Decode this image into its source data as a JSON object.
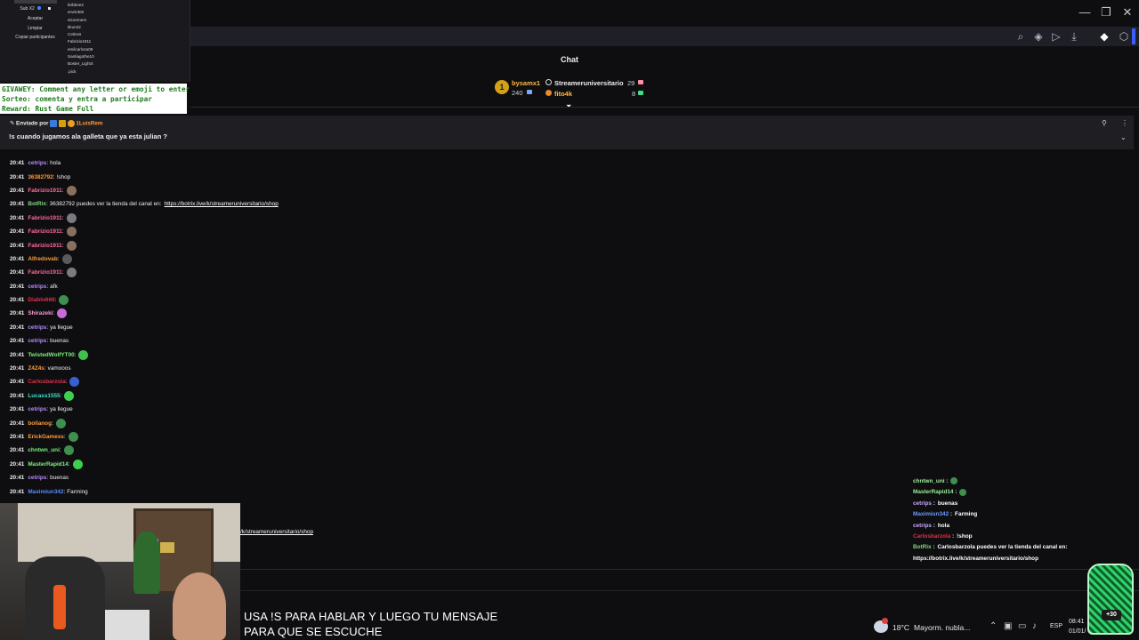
{
  "window": {
    "minimize_glyph": "—",
    "restore_glyph": "❐",
    "close_glyph": "✕"
  },
  "toolbar_icons": [
    "zoom-icon",
    "shield-icon",
    "play-icon",
    "download-icon",
    "extension-icon",
    "package-icon"
  ],
  "giveaway_panel": {
    "sub_label": "Sub X2",
    "accept_label": "Aceptar",
    "clear_label": "Limpiar",
    "copy_label": "Copiar participantes",
    "participants": [
      "birbbee2",
      "erv0r300",
      "elconmers",
      "tikun22",
      "Cetizes",
      "Fabrizio1911",
      "emilcarloza09",
      "Santiagothe10",
      "Boster_LightX",
      ".pick"
    ]
  },
  "giveaway_banner": {
    "line1": "GIVAWEY: Comment any letter or emoji to enter",
    "line2": "Sorteo: comenta y entra a participar",
    "line3": "Reward: Rust Game Full"
  },
  "chat_header": {
    "title": "Chat",
    "top_gifter_rank": "1",
    "top_gifter_name": "bysamx1",
    "top_gifter_count": "240",
    "channel_name": "Streameruniversitario",
    "channel_count": "29",
    "second_name": "fito4k",
    "second_count": "8"
  },
  "pinned": {
    "label": "Enviado por",
    "author": "1LuisRem",
    "message": "!s cuando jugamos ala galleta que ya esta julian ?"
  },
  "messages": [
    {
      "ts": "20:41",
      "user": "cetrips",
      "sep": ":",
      "text": "hola",
      "color": "#b78bff"
    },
    {
      "ts": "20:41",
      "user": "36382792",
      "sep": ":",
      "text": "!shop",
      "color": "#ff9a3c"
    },
    {
      "ts": "20:41",
      "user": "Fabrizio1911",
      "sep": ":",
      "text": "",
      "color": "#ff6b9a",
      "emote": "#8a6f5c"
    },
    {
      "ts": "20:41",
      "user": "BotRix",
      "sep": ":",
      "text": "36382792 puedes ver la tienda del canal en:",
      "link": "https://botrix.live/k/streameruniversitario/shop",
      "color": "#7dd87d"
    },
    {
      "ts": "20:41",
      "user": "Fabrizio1911",
      "sep": ":",
      "text": "",
      "color": "#ff6b9a",
      "emote": "#7a7a80"
    },
    {
      "ts": "20:41",
      "user": "Fabrizio1911",
      "sep": ":",
      "text": "",
      "color": "#ff6b9a",
      "emote": "#8a6f5c"
    },
    {
      "ts": "20:41",
      "user": "Fabrizio1911",
      "sep": ":",
      "text": "",
      "color": "#ff6b9a",
      "emote": "#8a6f5c"
    },
    {
      "ts": "20:41",
      "user": "Alfredovab",
      "sep": ":",
      "text": "",
      "color": "#ff9a3c",
      "emote": "#5a5a5a"
    },
    {
      "ts": "20:41",
      "user": "Fabrizio1911",
      "sep": ":",
      "text": "",
      "color": "#ff6b9a",
      "emote": "#7a7a80"
    },
    {
      "ts": "20:41",
      "user": "cetrips",
      "sep": ":",
      "text": "afk",
      "color": "#b78bff"
    },
    {
      "ts": "20:41",
      "user": "Diablo666",
      "sep": ":",
      "text": "",
      "color": "#e0304a",
      "emote": "#3f8f4f"
    },
    {
      "ts": "20:41",
      "user": "Shirazeki",
      "sep": ":",
      "text": "",
      "color": "#ff9ad8",
      "emote": "#c86bd8"
    },
    {
      "ts": "20:41",
      "user": "cetrips",
      "sep": ":",
      "text": "ya llegue",
      "color": "#b78bff"
    },
    {
      "ts": "20:41",
      "user": "cetrips",
      "sep": ":",
      "text": "buenas",
      "color": "#b78bff"
    },
    {
      "ts": "20:41",
      "user": "TwistedWolfYT00",
      "sep": ":",
      "text": "",
      "color": "#7df07d",
      "emote": "#3fbf4f"
    },
    {
      "ts": "20:41",
      "user": "Z4Z4s",
      "sep": ":",
      "text": "vamooos",
      "color": "#ff9a3c"
    },
    {
      "ts": "20:41",
      "user": "Carlosbarzola",
      "sep": ":",
      "text": "",
      "color": "#e0304a",
      "emote": "#3a5fd0"
    },
    {
      "ts": "20:41",
      "user": "Lucass1555",
      "sep": ":",
      "text": "",
      "color": "#3ce0d0",
      "emote": "#3fcf4f"
    },
    {
      "ts": "20:41",
      "user": "cetrips",
      "sep": ":",
      "text": "ya llegue",
      "color": "#b78bff"
    },
    {
      "ts": "20:41",
      "user": "bollanog",
      "sep": ":",
      "text": "",
      "color": "#ff9a3c",
      "emote": "#3f8f4f"
    },
    {
      "ts": "20:41",
      "user": "ErickGamess",
      "sep": ":",
      "text": "",
      "color": "#ff9a3c",
      "emote": "#3f8f4f"
    },
    {
      "ts": "20:41",
      "user": "chntwn_uni",
      "sep": ":",
      "text": "",
      "color": "#7df07d",
      "emote": "#3f8f4f"
    },
    {
      "ts": "20:41",
      "user": "MasterRapid14",
      "sep": ":",
      "text": "",
      "color": "#7df07d",
      "emote": "#3fcf4f"
    },
    {
      "ts": "20:41",
      "user": "cetrips",
      "sep": ":",
      "text": "buenas",
      "color": "#b78bff"
    },
    {
      "ts": "20:41",
      "user": "Maximiun342",
      "sep": ":",
      "text": "Farming",
      "color": "#5a8cff"
    }
  ],
  "stream_link_fragment": "/k/streameruniversitario/shop",
  "overlay_chat": [
    {
      "user": "chntwn_uni",
      "sep": " :",
      "text": "",
      "color": "#9cf09c"
    },
    {
      "user": "MasterRapid14",
      "sep": " :",
      "text": "",
      "color": "#9cf09c"
    },
    {
      "user": "cetrips",
      "sep": " :",
      "text": "buenas",
      "color": "#c8a8ff"
    },
    {
      "user": "Maximiun342",
      "sep": " :",
      "text": "Farming",
      "color": "#6a9cff"
    },
    {
      "user": "cetrips",
      "sep": " :",
      "text": "hola",
      "color": "#c8a8ff"
    },
    {
      "user": "Carlosbarzola",
      "sep": " :",
      "text": "!shop",
      "color": "#e0304a"
    },
    {
      "user": "BotRix",
      "sep": " :",
      "text": "Carlosbarzola puedes ver la tienda del canal en:",
      "color": "#7dd87d"
    }
  ],
  "overlay_link": "https://botrix.live/k/streameruniversitario/shop",
  "caption": {
    "line1": "USA !S PARA HABLAR Y LUEGO TU MENSAJE",
    "line2": "PARA QUE SE ESCUCHE"
  },
  "taskbar": {
    "weather_temp": "18°C",
    "weather_text": "Mayorm. nubla...",
    "language": "ESP",
    "time": "08:41",
    "date": "01/01/"
  },
  "mascot_text": "+30"
}
